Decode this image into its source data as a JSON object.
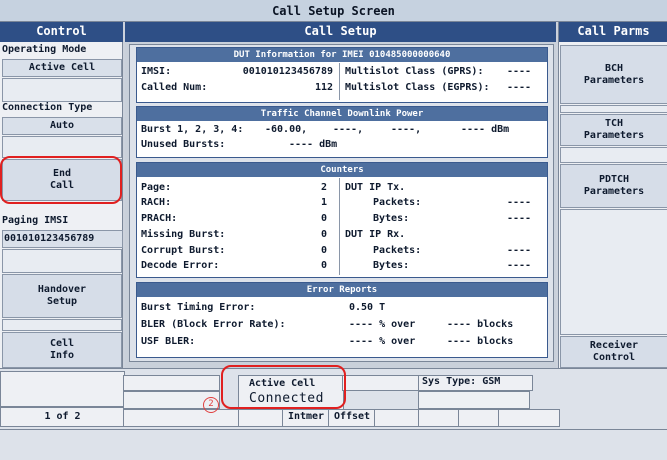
{
  "title": "Call Setup Screen",
  "left": {
    "header": "Control",
    "operating_mode_label": "Operating Mode",
    "operating_mode_value": "Active Cell",
    "connection_type_label": "Connection Type",
    "connection_type_value": "Auto",
    "end_call_line1": "End",
    "end_call_line2": "Call",
    "paging_imsi_label": "Paging IMSI",
    "paging_imsi_value": "001010123456789",
    "handover_line1": "Handover",
    "handover_line2": "Setup",
    "cell_info_line1": "Cell",
    "cell_info_line2": "Info",
    "page_indicator": "1 of 2"
  },
  "center": {
    "header": "Call Setup",
    "dut": {
      "title": "DUT Information for IMEI 010485000000640",
      "imsi_label": "IMSI:",
      "imsi_value": "001010123456789",
      "called_label": "Called Num:",
      "called_value": "112",
      "ms_gprs_label": "Multislot Class (GPRS):",
      "ms_gprs_value": "----",
      "ms_egprs_label": "Multislot Class (EGPRS):",
      "ms_egprs_value": "----"
    },
    "traffic": {
      "title": "Traffic Channel Downlink Power",
      "burst_label": "Burst 1, 2, 3, 4:",
      "burst_v1": "-60.00,",
      "burst_v2": "----,",
      "burst_v3": "----,",
      "burst_v4": "---- dBm",
      "unused_label": "Unused Bursts:",
      "unused_value": "---- dBm"
    },
    "counters": {
      "title": "Counters",
      "rows": [
        {
          "label": "Page:",
          "value": "2"
        },
        {
          "label": "RACH:",
          "value": "1"
        },
        {
          "label": "PRACH:",
          "value": "0"
        },
        {
          "label": "Missing Burst:",
          "value": "0"
        },
        {
          "label": "Corrupt Burst:",
          "value": "0"
        },
        {
          "label": "Decode Error:",
          "value": "0"
        }
      ],
      "tx_label": "DUT IP Tx.",
      "tx_packets_label": "Packets:",
      "tx_packets_value": "----",
      "tx_bytes_label": "Bytes:",
      "tx_bytes_value": "----",
      "rx_label": "DUT IP Rx.",
      "rx_packets_label": "Packets:",
      "rx_packets_value": "----",
      "rx_bytes_label": "Bytes:",
      "rx_bytes_value": "----"
    },
    "errors": {
      "title": "Error Reports",
      "burst_timing_label": "Burst Timing Error:",
      "burst_timing_value": "0.50 T",
      "bler_label": "BLER (Block Error Rate):",
      "bler_value": "---- % over",
      "bler_blocks": "---- blocks",
      "usf_label": "USF BLER:",
      "usf_value": "---- % over",
      "usf_blocks": "---- blocks"
    }
  },
  "right": {
    "header": "Call Parms",
    "bch_line1": "BCH",
    "bch_line2": "Parameters",
    "tch_line1": "TCH",
    "tch_line2": "Parameters",
    "pdtch_line1": "PDTCH",
    "pdtch_line2": "Parameters",
    "receiver_line1": "Receiver",
    "receiver_line2": "Control"
  },
  "status": {
    "cell_state": "Active Cell",
    "connection": "Connected",
    "sys_type": "Sys Type: GSM",
    "intmer": "Intmer",
    "offset": "Offset",
    "annotation_number": "2"
  }
}
